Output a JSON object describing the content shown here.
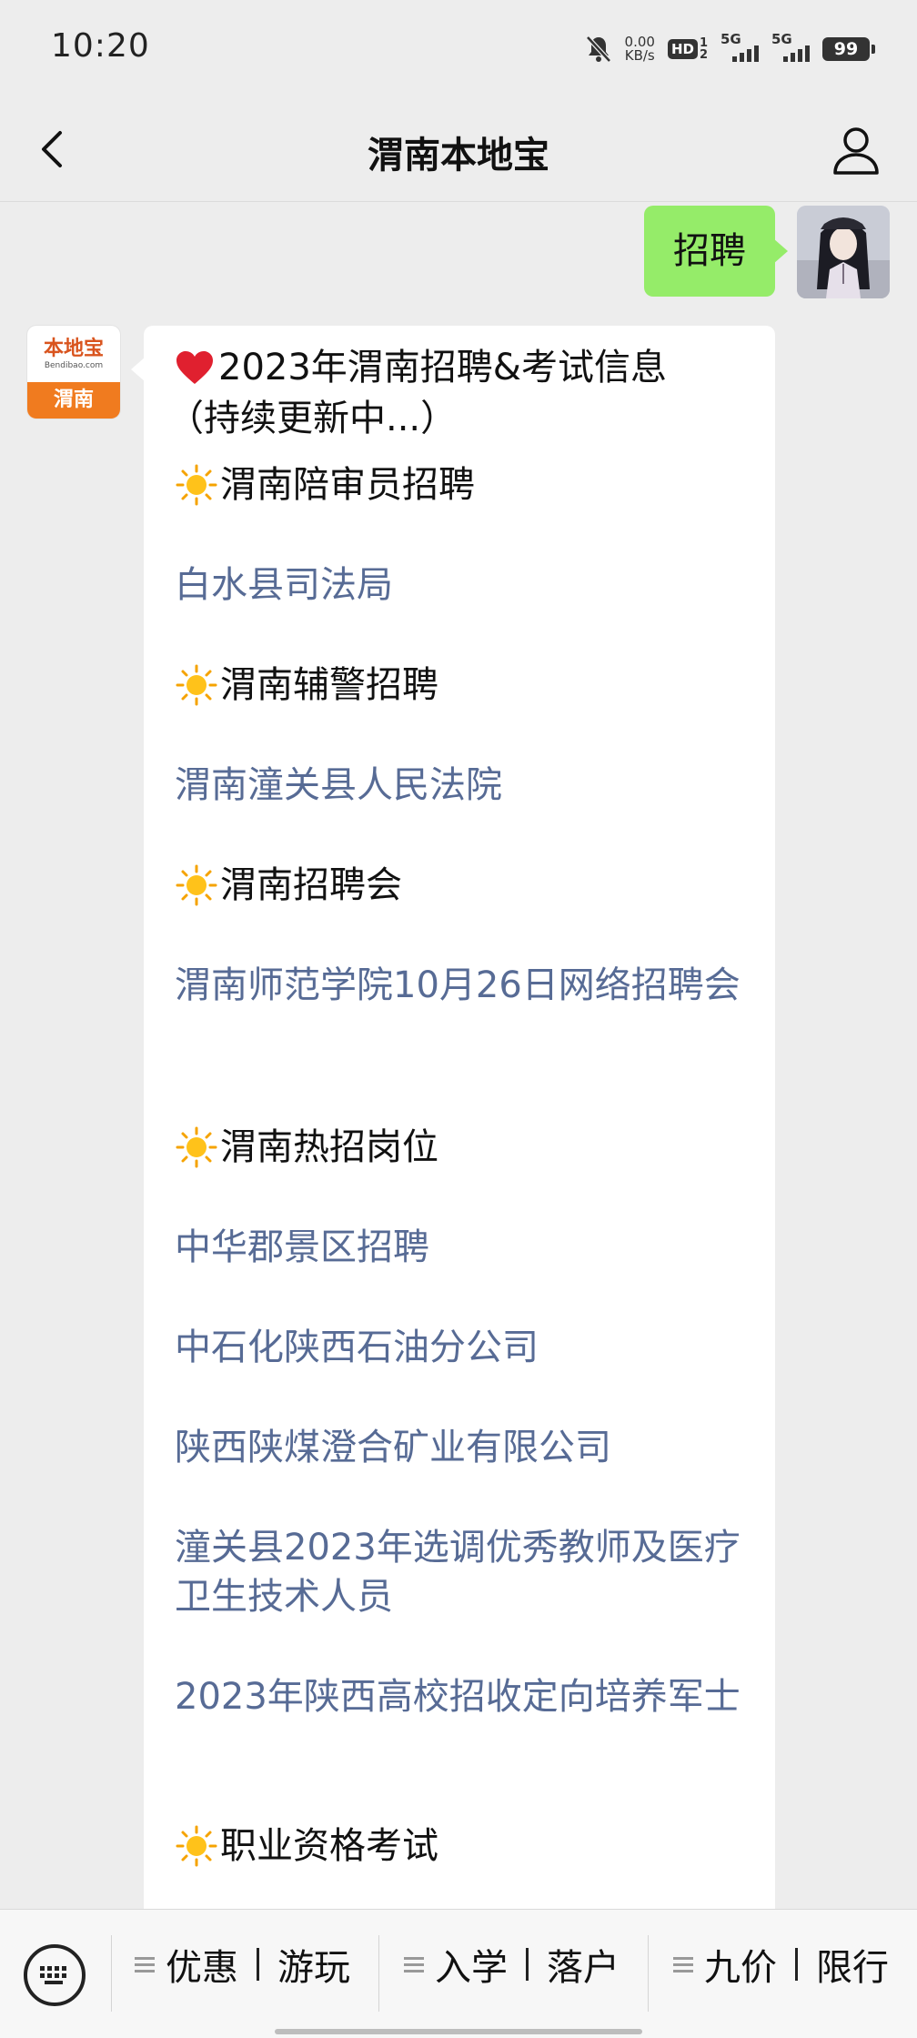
{
  "status_bar": {
    "time": "10:20",
    "speed_value": "0.00",
    "speed_unit": "KB/s",
    "hd_label": "HD",
    "hd_sub1": "1",
    "hd_sub2": "2",
    "sim1_label": "5G",
    "sim2_label": "5G",
    "battery": "99",
    "icons": [
      "mute-bell-icon",
      "hd-voice-icon",
      "signal-icon",
      "battery-icon"
    ]
  },
  "nav": {
    "title": "渭南本地宝",
    "back_icon": "chevron-left-icon",
    "profile_icon": "user-icon"
  },
  "chat": {
    "sent_message": "招聘",
    "official_account_logo": {
      "brand": "本地宝",
      "url": "Bendibao.com",
      "city": "渭南"
    },
    "reply": {
      "title": "2023年渭南招聘&考试信息",
      "subtitle": "（持续更新中...）",
      "lines": [
        {
          "type": "category",
          "text": "渭南陪审员招聘"
        },
        {
          "type": "link",
          "text": "白水县司法局"
        },
        {
          "type": "category",
          "text": "渭南辅警招聘"
        },
        {
          "type": "link",
          "text": "渭南潼关县人民法院"
        },
        {
          "type": "category",
          "text": "渭南招聘会"
        },
        {
          "type": "link",
          "text": "渭南师范学院10月26日网络招聘会"
        },
        {
          "type": "category",
          "text": "渭南热招岗位"
        },
        {
          "type": "link",
          "text": "中华郡景区招聘"
        },
        {
          "type": "link",
          "text": "中石化陕西石油分公司"
        },
        {
          "type": "link",
          "text": "陕西陕煤澄合矿业有限公司"
        },
        {
          "type": "link",
          "text": "潼关县2023年选调优秀教师及医疗卫生技术人员"
        },
        {
          "type": "link",
          "text": "2023年陕西高校招收定向培养军士"
        },
        {
          "type": "category",
          "text": "职业资格考试"
        }
      ]
    }
  },
  "bottom_menu": {
    "keyboard_icon": "keyboard-icon",
    "menus": [
      {
        "left": "优惠",
        "right": "游玩"
      },
      {
        "left": "入学",
        "right": "落户"
      },
      {
        "left": "九价",
        "right": "限行"
      }
    ]
  },
  "colors": {
    "background": "#ededed",
    "sent_bubble": "#95ec69",
    "link": "#576b95",
    "logo_orange": "#f07b1f"
  }
}
